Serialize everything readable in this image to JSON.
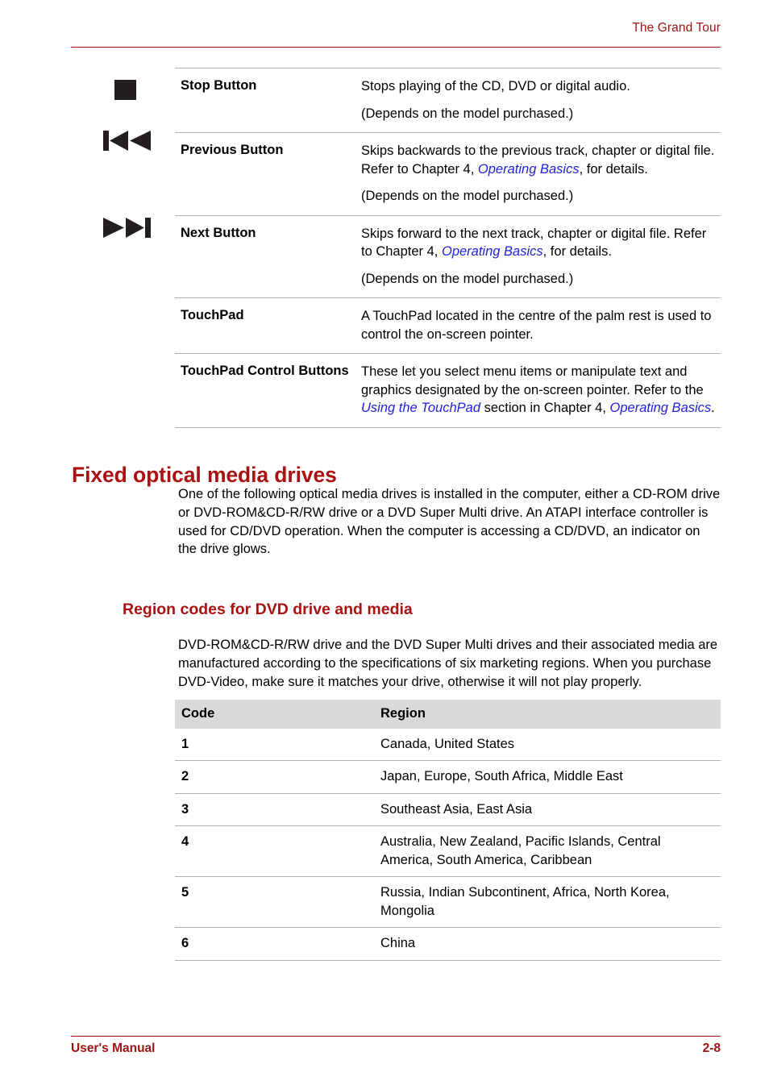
{
  "header": {
    "title": "The Grand Tour"
  },
  "feature_table": {
    "rows": [
      {
        "icon": "stop-icon",
        "label": "Stop Button",
        "paragraphs": [
          {
            "segments": [
              {
                "text": "Stops playing of the CD, DVD or digital audio.",
                "style": "plain"
              }
            ]
          },
          {
            "segments": [
              {
                "text": "(Depends on the model purchased.)",
                "style": "plain"
              }
            ]
          }
        ]
      },
      {
        "icon": "previous-track-icon",
        "label": "Previous Button",
        "paragraphs": [
          {
            "segments": [
              {
                "text": "Skips backwards to the previous track, chapter or digital file. Refer to Chapter 4, ",
                "style": "plain"
              },
              {
                "text": "Operating Basics",
                "style": "xref"
              },
              {
                "text": ", for details.",
                "style": "plain"
              }
            ]
          },
          {
            "segments": [
              {
                "text": "(Depends on the model purchased.)",
                "style": "plain"
              }
            ]
          }
        ]
      },
      {
        "icon": "next-track-icon",
        "label": "Next Button",
        "paragraphs": [
          {
            "segments": [
              {
                "text": "Skips forward to the next track, chapter or digital file. Refer to Chapter 4, ",
                "style": "plain"
              },
              {
                "text": "Operating Basics",
                "style": "xref"
              },
              {
                "text": ", for details.",
                "style": "plain"
              }
            ]
          },
          {
            "segments": [
              {
                "text": "(Depends on the model purchased.)",
                "style": "plain"
              }
            ]
          }
        ]
      },
      {
        "icon": null,
        "label": "TouchPad",
        "paragraphs": [
          {
            "segments": [
              {
                "text": "A TouchPad located in the centre of the palm rest is used to control the on-screen pointer.",
                "style": "plain"
              }
            ]
          }
        ]
      },
      {
        "icon": null,
        "label": "TouchPad Control Buttons",
        "paragraphs": [
          {
            "segments": [
              {
                "text": "These let you select menu items or manipulate text and graphics designated by the on-screen pointer. Refer to the ",
                "style": "plain"
              },
              {
                "text": "Using the TouchPad",
                "style": "xref"
              },
              {
                "text": " section in Chapter 4, ",
                "style": "plain"
              },
              {
                "text": "Operating Basics",
                "style": "xref"
              },
              {
                "text": ".",
                "style": "plain"
              }
            ]
          }
        ]
      }
    ]
  },
  "sections": {
    "optical_drives": {
      "heading": "Fixed optical media drives",
      "paragraph": "One of the following optical media drives is installed in the computer, either a CD-ROM drive or DVD-ROM&CD-R/RW drive or a DVD Super Multi drive. An ATAPI interface controller is used for CD/DVD operation. When the computer is accessing a CD/DVD, an indicator on the drive glows."
    },
    "region_codes": {
      "heading": "Region codes for DVD drive and media",
      "paragraph": "DVD-ROM&CD-R/RW drive and the DVD Super Multi drives and their associated media are manufactured according to the specifications of six marketing regions. When you purchase DVD-Video, make sure it matches your drive, otherwise it will not play properly."
    }
  },
  "region_table": {
    "columns": [
      "Code",
      "Region"
    ],
    "rows": [
      [
        "1",
        "Canada, United States"
      ],
      [
        "2",
        "Japan, Europe, South Africa, Middle East"
      ],
      [
        "3",
        "Southeast Asia, East Asia"
      ],
      [
        "4",
        "Australia, New Zealand, Pacific Islands, Central America, South America, Caribbean"
      ],
      [
        "5",
        "Russia, Indian Subcontinent, Africa, North Korea, Mongolia"
      ],
      [
        "6",
        "China"
      ]
    ]
  },
  "footer": {
    "manual_label": "User's Manual",
    "page_number": "2-8"
  },
  "colors": {
    "accent_red": "#9e1313",
    "heading_red": "#a81212",
    "xref_blue": "#1f1fdd",
    "table_header_gray": "#d9d9d9",
    "rule_gray": "#b3b3b3"
  }
}
